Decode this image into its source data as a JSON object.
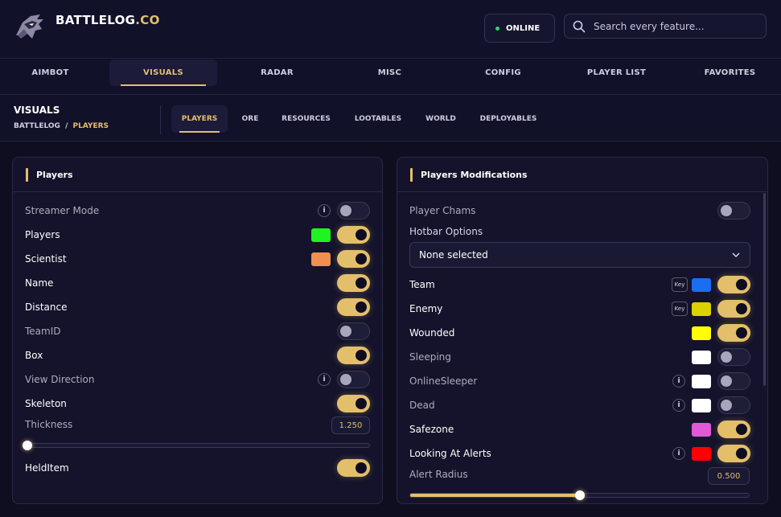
{
  "app": {
    "brand_main": "BATTLELOG",
    "brand_accent": ".CO",
    "status": "ONLINE"
  },
  "search": {
    "placeholder": "Search every feature..."
  },
  "main_tabs": [
    {
      "label": "AIMBOT",
      "active": false
    },
    {
      "label": "VISUALS",
      "active": true
    },
    {
      "label": "RADAR",
      "active": false
    },
    {
      "label": "MISC",
      "active": false
    },
    {
      "label": "CONFIG",
      "active": false
    },
    {
      "label": "PLAYER LIST",
      "active": false
    },
    {
      "label": "FAVORITES",
      "active": false
    }
  ],
  "section": {
    "title": "VISUALS",
    "crumb_root": "BATTLELOG",
    "crumb_sep": "/",
    "crumb_current": "PLAYERS"
  },
  "sub_tabs": [
    {
      "label": "PLAYERS",
      "active": true
    },
    {
      "label": "ORE",
      "active": false
    },
    {
      "label": "RESOURCES",
      "active": false
    },
    {
      "label": "LOOTABLES",
      "active": false
    },
    {
      "label": "WORLD",
      "active": false
    },
    {
      "label": "DEPLOYABLES",
      "active": false
    }
  ],
  "left_panel": {
    "title": "Players",
    "rows": [
      {
        "label": "Streamer Mode",
        "on": false,
        "info": "i"
      },
      {
        "label": "Players",
        "on": true,
        "color": "#1ef41e"
      },
      {
        "label": "Scientist",
        "on": true,
        "color": "#f0904f"
      },
      {
        "label": "Name",
        "on": true
      },
      {
        "label": "Distance",
        "on": true
      },
      {
        "label": "TeamID",
        "on": false
      },
      {
        "label": "Box",
        "on": true
      },
      {
        "label": "View Direction",
        "on": false,
        "info": "i"
      },
      {
        "label": "Skeleton",
        "on": true
      }
    ],
    "thickness": {
      "label": "Thickness",
      "value": "1.250",
      "fraction": 0.0
    },
    "helditem": {
      "label": "HeldItem",
      "on": true
    }
  },
  "right_panel": {
    "title": "Players Modifications",
    "chams": {
      "label": "Player Chams",
      "on": false
    },
    "hotbar": {
      "label": "Hotbar Options",
      "selected": "None selected"
    },
    "rows": [
      {
        "label": "Team",
        "on": true,
        "color": "#1a6ef0",
        "key": "Key"
      },
      {
        "label": "Enemy",
        "on": true,
        "color": "#dcd200",
        "key": "Key"
      },
      {
        "label": "Wounded",
        "on": true,
        "color": "#ffff00"
      },
      {
        "label": "Sleeping",
        "on": false,
        "color": "#ffffff"
      },
      {
        "label": "OnlineSleeper",
        "on": false,
        "color": "#ffffff",
        "info": "i"
      },
      {
        "label": "Dead",
        "on": false,
        "color": "#ffffff",
        "info": "i"
      },
      {
        "label": "Safezone",
        "on": true,
        "color": "#e05ad8"
      },
      {
        "label": "Looking At Alerts",
        "on": true,
        "color": "#ff0000",
        "info": "i"
      }
    ],
    "alert_radius": {
      "label": "Alert Radius",
      "value": "0.500",
      "fraction": 0.5
    }
  },
  "colors": {
    "accent": "#e4bf6b",
    "online": "#2fd36a"
  }
}
